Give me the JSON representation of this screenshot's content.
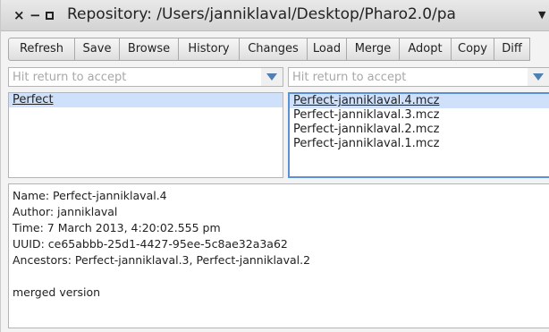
{
  "window": {
    "title": "Repository: /Users/janniklaval/Desktop/Pharo2.0/pa",
    "close_glyph": "×",
    "minimize_glyph": "−",
    "menu_glyph": "▼"
  },
  "toolbar": {
    "buttons": [
      "Refresh",
      "Save",
      "Browse",
      "History",
      "Changes",
      "Load",
      "Merge",
      "Adopt",
      "Copy",
      "Diff"
    ]
  },
  "filters": {
    "left_placeholder": "Hit return to accept",
    "right_placeholder": "Hit return to accept"
  },
  "packages": {
    "items": [
      "Perfect"
    ],
    "selected": "Perfect"
  },
  "versions": {
    "items": [
      "Perfect-janniklaval.4.mcz",
      "Perfect-janniklaval.3.mcz",
      "Perfect-janniklaval.2.mcz",
      "Perfect-janniklaval.1.mcz"
    ],
    "selected": "Perfect-janniklaval.4.mcz"
  },
  "details": {
    "name": "Name: Perfect-janniklaval.4",
    "author": "Author: janniklaval",
    "time": "Time: 7 March 2013, 4:20:02.555 pm",
    "uuid": "UUID: ce65abbb-25d1-4427-95ee-5c8ae32a3a62",
    "ancestors": "Ancestors: Perfect-janniklaval.3, Perfect-janniklaval.2",
    "message": "merged version"
  },
  "colors": {
    "selection": "#cfe1fa",
    "focus_border": "#5b8fd6",
    "dropdown_arrow": "#4f7fb3"
  }
}
